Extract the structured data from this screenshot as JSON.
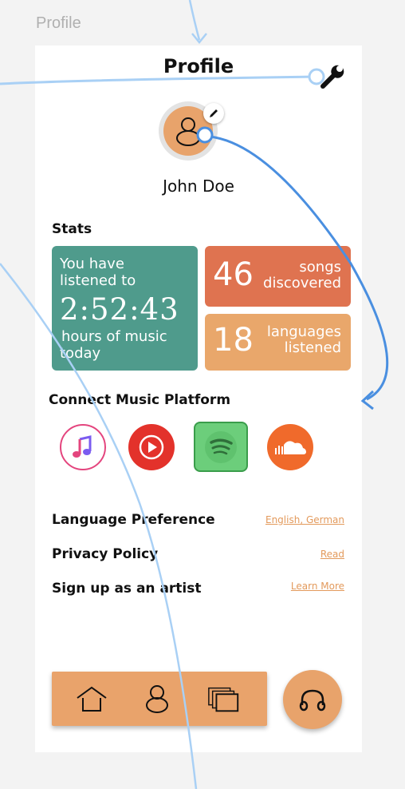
{
  "frame": {
    "label": "Profile"
  },
  "header": {
    "title": "Profile",
    "settings_icon": "wrench-icon"
  },
  "profile": {
    "name": "John Doe",
    "avatar_icon": "person-icon",
    "edit_icon": "pencil-icon"
  },
  "stats": {
    "heading": "Stats",
    "listening": {
      "line1": "You have",
      "line2": "listened to",
      "time": "2:52:43",
      "line3": "hours of music",
      "line4": "today"
    },
    "songs": {
      "number": "46",
      "label1": "songs",
      "label2": "discovered"
    },
    "languages": {
      "number": "18",
      "label1": "languages",
      "label2": "listened"
    }
  },
  "platforms": {
    "heading": "Connect Music Platform",
    "items": [
      {
        "name": "Apple Music",
        "icon": "apple-music-icon"
      },
      {
        "name": "YouTube Music",
        "icon": "youtube-music-icon"
      },
      {
        "name": "Spotify",
        "icon": "spotify-icon",
        "selected": true
      },
      {
        "name": "SoundCloud",
        "icon": "soundcloud-icon"
      }
    ]
  },
  "settings": [
    {
      "label": "Language Preference",
      "link": "English, German"
    },
    {
      "label": "Privacy Policy",
      "link": "Read"
    },
    {
      "label": "Sign up as an artist",
      "link": "Learn More"
    }
  ],
  "nav": {
    "items": [
      "home-icon",
      "profile-icon",
      "library-icon"
    ],
    "fab_icon": "headphones-icon"
  },
  "colors": {
    "accent": "#e8a36b",
    "teal": "#4f9b8c",
    "coral": "#df7350",
    "link": "#e39a5c",
    "prototype_arrow": "#4a8fe0"
  }
}
